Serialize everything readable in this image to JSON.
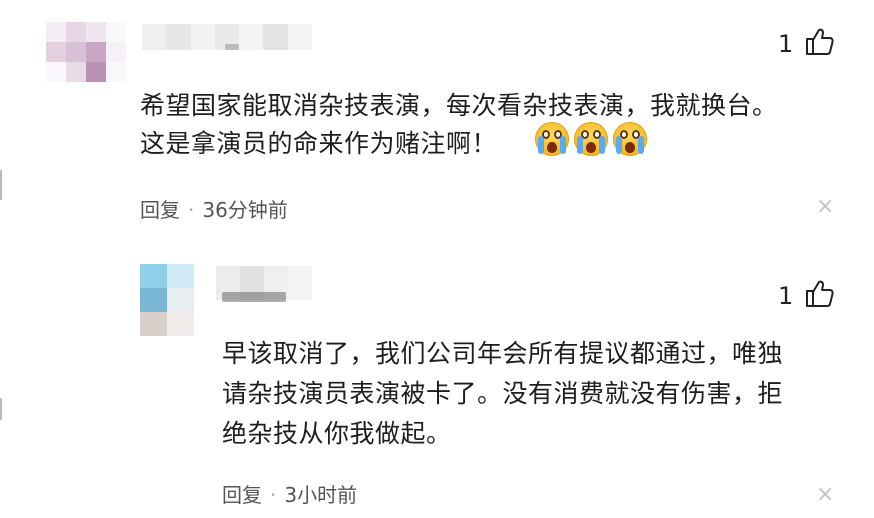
{
  "comments": [
    {
      "likes": "1",
      "text_lines": [
        "希望国家能取消杂技表演，每次看杂技表演，我就换台。",
        "这是拿演员的命来作为赌注啊！"
      ],
      "reply_label": "回复",
      "separator": "·",
      "time": "36分钟前",
      "emoji_count": 3
    },
    {
      "likes": "1",
      "text_lines": [
        "早该取消了，我们公司年会所有提议都通过，唯独",
        "请杂技演员表演被卡了。没有消费就没有伤害，拒",
        "绝杂技从你我做起。"
      ],
      "reply_label": "回复",
      "separator": "·",
      "time": "3小时前"
    }
  ],
  "icons": {
    "like": "thumbs-up-icon",
    "close": "close-icon",
    "emoji": "loudly-crying-face-icon"
  },
  "close_glyph": "×",
  "colors": {
    "text": "#1e1e1e",
    "meta": "#555555",
    "close": "#c2c2c2"
  }
}
